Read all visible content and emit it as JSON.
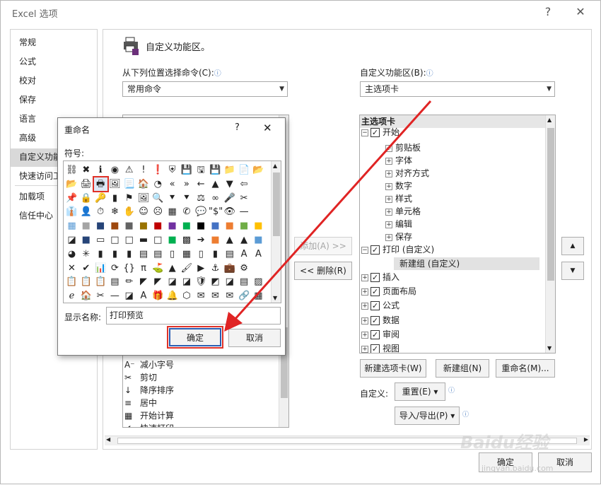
{
  "window": {
    "title": "Excel 选项",
    "help": "?",
    "close": "✕"
  },
  "nav": {
    "items": [
      {
        "label": "常规",
        "selected": false
      },
      {
        "label": "公式",
        "selected": false
      },
      {
        "label": "校对",
        "selected": false
      },
      {
        "label": "保存",
        "selected": false
      },
      {
        "label": "语言",
        "selected": false
      },
      {
        "label": "高级",
        "selected": false
      },
      {
        "label": "自定义功能区",
        "selected": true
      },
      {
        "label": "快速访问工具栏",
        "selected": false
      },
      {
        "label": "加载项",
        "selected": false
      },
      {
        "label": "信任中心",
        "selected": false
      }
    ]
  },
  "main": {
    "heading": "自定义功能区。",
    "from_label": "从下列位置选择命令(C):",
    "from_value": "常用命令",
    "ribbon_label": "自定义功能区(B):",
    "ribbon_value": "主选项卡",
    "info": "ⓘ",
    "left_list": [
      {
        "icon": "A⁻",
        "label": "减小字号"
      },
      {
        "icon": "✂",
        "label": "剪切"
      },
      {
        "icon": "↓",
        "label": "降序排序"
      },
      {
        "icon": "≡",
        "label": "居中"
      },
      {
        "icon": "▦",
        "label": "开始计算"
      },
      {
        "icon": "✔",
        "label": "快速打印"
      }
    ],
    "add_button": "添加(A) >>",
    "remove_button": "<< 删除(R)",
    "tree_header": "主选项卡",
    "tree": [
      {
        "label": "开始",
        "indent": 0,
        "exp": "⊟",
        "check": true
      },
      {
        "label": "剪贴板",
        "indent": 1,
        "exp": "⊞",
        "check": false
      },
      {
        "label": "字体",
        "indent": 1,
        "exp": "⊞",
        "check": false
      },
      {
        "label": "对齐方式",
        "indent": 1,
        "exp": "⊞",
        "check": false
      },
      {
        "label": "数字",
        "indent": 1,
        "exp": "⊞",
        "check": false
      },
      {
        "label": "样式",
        "indent": 1,
        "exp": "⊞",
        "check": false
      },
      {
        "label": "单元格",
        "indent": 1,
        "exp": "⊞",
        "check": false
      },
      {
        "label": "编辑",
        "indent": 1,
        "exp": "⊞",
        "check": false
      },
      {
        "label": "保存",
        "indent": 1,
        "exp": "⊞",
        "check": false
      },
      {
        "label": "打印 (自定义)",
        "indent": 0,
        "exp": "⊟",
        "check": true
      },
      {
        "label": "新建组 (自定义)",
        "indent": 2,
        "exp": "",
        "check": false,
        "selected": true
      },
      {
        "label": "插入",
        "indent": 0,
        "exp": "⊞",
        "check": true
      },
      {
        "label": "页面布局",
        "indent": 0,
        "exp": "⊞",
        "check": true
      },
      {
        "label": "公式",
        "indent": 0,
        "exp": "⊞",
        "check": true
      },
      {
        "label": "数据",
        "indent": 0,
        "exp": "⊞",
        "check": true
      },
      {
        "label": "审阅",
        "indent": 0,
        "exp": "⊞",
        "check": true
      },
      {
        "label": "视图",
        "indent": 0,
        "exp": "⊞",
        "check": true
      }
    ],
    "new_tab": "新建选项卡(W)",
    "new_group": "新建组(N)",
    "rename": "重命名(M)...",
    "customize_label": "自定义:",
    "reset": "重置(E) ▾",
    "import_export": "导入/导出(P) ▾",
    "ok": "确定",
    "cancel": "取消",
    "watermark": "Baidu经验",
    "watermark_sub": "jingyan.baidu.com"
  },
  "rename_dialog": {
    "title": "重命名",
    "help": "?",
    "close": "✕",
    "symbol_label": "符号:",
    "display_label": "显示名称:",
    "display_value": "打印预览",
    "ok": "确定",
    "cancel": "取消",
    "symbols": [
      [
        "⛓",
        "✖",
        "ℹ",
        "◉",
        "⚠",
        "!",
        "❗",
        "⛨",
        "💾",
        "🖫",
        "💾",
        "📁",
        "📄",
        "📂"
      ],
      [
        "📂",
        "🖨",
        "🖶",
        "🖼",
        "📃",
        "🏠",
        "◔",
        "«",
        "»",
        "←",
        "▲",
        "▼",
        "⇦"
      ],
      [
        "📌",
        "🔒",
        "🔑",
        "▮",
        "⚑",
        "🖼",
        "🔍",
        "⯆",
        "⯆",
        "⚖",
        "∞",
        "🎤",
        "✂"
      ],
      [
        "👔",
        "👤",
        "⏱",
        "❄",
        "✋",
        "☺",
        "☹",
        "▦",
        "✆",
        "💬",
        "\"$\"",
        "👁",
        "—"
      ],
      [
        "▦",
        "■",
        "■",
        "■",
        "■",
        "■",
        "■",
        "■",
        "■",
        "■",
        "■",
        "■",
        "■",
        "■"
      ],
      [
        "◪",
        "■",
        "▭",
        "□",
        "□",
        "▬",
        "□",
        "■",
        "▩",
        "➔",
        "■",
        "▲",
        "▲",
        "■"
      ],
      [
        "◕",
        "✳",
        "▮",
        "▮",
        "▮",
        "▤",
        "▤",
        "▯",
        "▦",
        "▯",
        "▮",
        "▤",
        "A",
        "A"
      ],
      [
        "✕",
        "✔",
        "📊",
        "⟳",
        "{}",
        "π",
        "⛳",
        "▲",
        "🖌",
        "▶",
        "⚓",
        "💼",
        "⚙"
      ],
      [
        "📋",
        "📋",
        "📋",
        "▤",
        "✏",
        "◤",
        "◤",
        "◪",
        "◪",
        "🛡",
        "◩",
        "◪",
        "▤",
        "▨"
      ],
      [
        "ℯ",
        "🏠",
        "✂",
        "—",
        "◪",
        "A",
        "🎁",
        "🔔",
        "⬡",
        "✉",
        "✉",
        "✉",
        "🔗",
        "▦"
      ]
    ]
  }
}
